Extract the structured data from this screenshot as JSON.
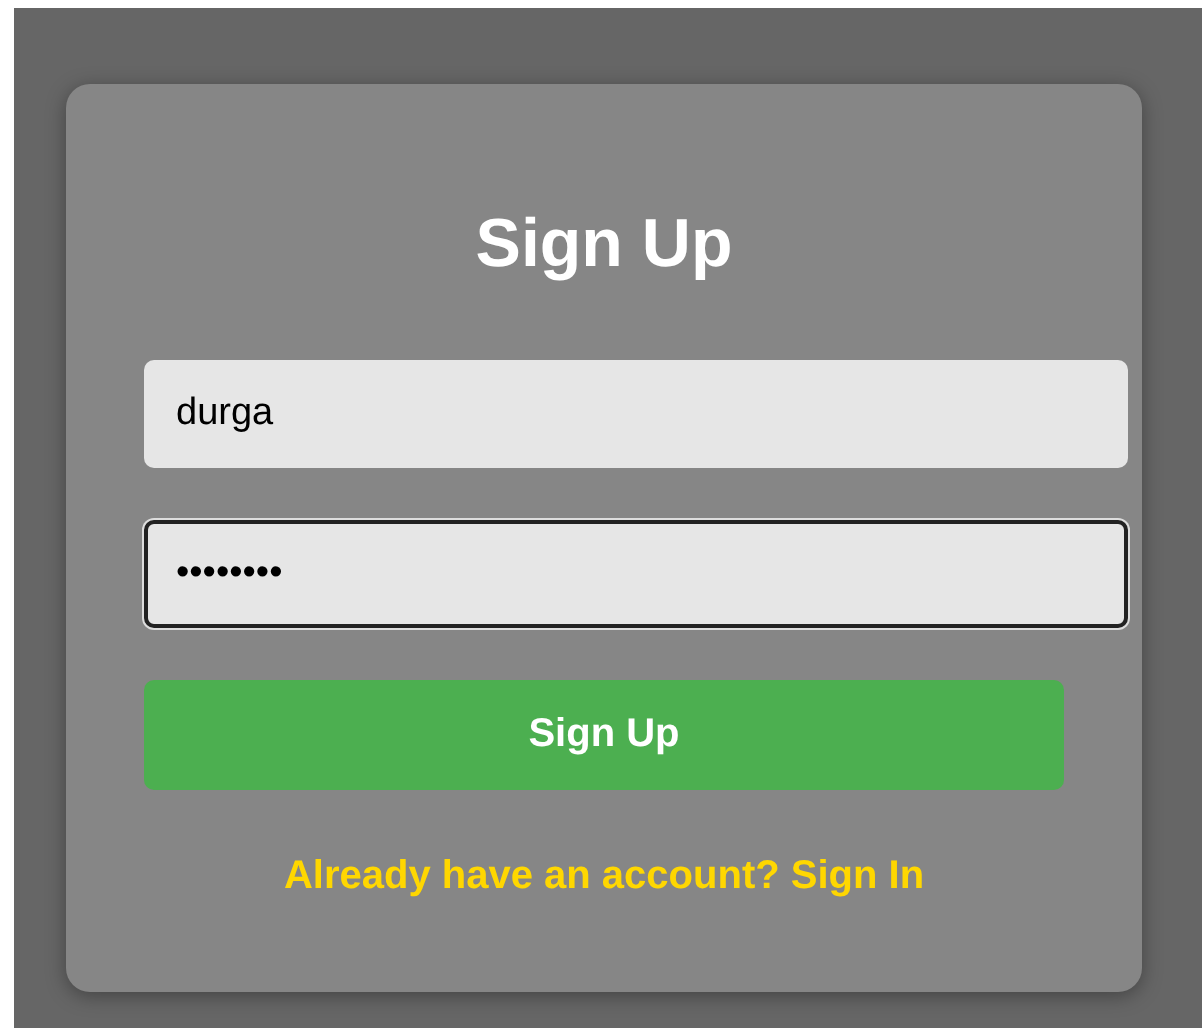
{
  "title": "Sign Up",
  "fields": [
    {
      "value": "durga",
      "focused": false
    },
    {
      "value": "••••••••",
      "focused": true
    }
  ],
  "button": "Sign Up",
  "link": "Already have an account? Sign In"
}
